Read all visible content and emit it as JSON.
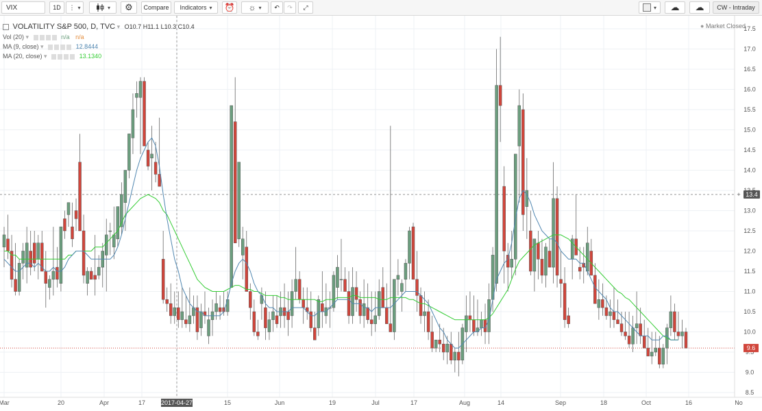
{
  "toolbar": {
    "symbol": "VIX",
    "interval": "1D",
    "compare_label": "Compare",
    "indicators_label": "Indicators",
    "layout_label": "CW - Intraday"
  },
  "legend": {
    "title": "VOLATILITY S&P 500, D, TVC",
    "ohlc": {
      "open": "O10.7",
      "high": "H11.1",
      "low": "L10.3",
      "close": "C10.4"
    },
    "vol": {
      "label": "Vol (20)",
      "v1": "n/a",
      "v2": "n/a"
    },
    "ma9": {
      "label": "MA (9, close)",
      "value": "12.8444"
    },
    "ma20": {
      "label": "MA (20, close)",
      "value": "13.1340"
    },
    "market_status": "Market Closed"
  },
  "colors": {
    "up": "#6b9e7e",
    "down": "#d1453b",
    "ma9": "#4f86b0",
    "ma20": "#33cc33",
    "grid": "#eef1f4",
    "crosshair": "#999999"
  },
  "y_axis": {
    "ticks": [
      "17.5",
      "17.0",
      "16.5",
      "16.0",
      "15.5",
      "15.0",
      "14.5",
      "14.0",
      "13.5",
      "13.0",
      "12.5",
      "12.0",
      "11.5",
      "11.0",
      "10.5",
      "10.0",
      "9.5",
      "9.0",
      "8.5"
    ],
    "crosshair_value": "13.4",
    "price_value": "9.6"
  },
  "x_axis": {
    "ticks": [
      "Mar",
      "20",
      "Apr",
      "17",
      "2017-04-27",
      "15",
      "Jun",
      "19",
      "Jul",
      "17",
      "Aug",
      "14",
      "Sep",
      "18",
      "Oct",
      "16",
      "No"
    ]
  },
  "chart_data": {
    "type": "candlestick",
    "title": "VOLATILITY S&P 500, D, TVC",
    "ylim": [
      8.5,
      17.5
    ],
    "ohlc": [
      [
        12.1,
        12.6,
        11.6,
        12.4
      ],
      [
        12.3,
        12.9,
        11.8,
        12.0
      ],
      [
        12.0,
        12.4,
        11.1,
        11.3
      ],
      [
        11.3,
        12.2,
        10.9,
        11.0
      ],
      [
        11.0,
        11.8,
        10.9,
        11.7
      ],
      [
        11.7,
        12.2,
        11.3,
        12.0
      ],
      [
        11.6,
        12.6,
        11.2,
        12.2
      ],
      [
        12.0,
        12.5,
        11.4,
        11.6
      ],
      [
        12.2,
        12.5,
        11.5,
        11.7
      ],
      [
        11.8,
        12.4,
        11.3,
        12.2
      ],
      [
        12.2,
        12.5,
        11.6,
        11.5
      ],
      [
        11.5,
        12.0,
        10.6,
        11.2
      ],
      [
        11.1,
        11.4,
        10.8,
        11.3
      ],
      [
        11.3,
        12.6,
        10.9,
        11.5
      ],
      [
        11.6,
        12.1,
        11.1,
        11.3
      ],
      [
        11.2,
        12.4,
        11.0,
        12.6
      ],
      [
        12.8,
        13.0,
        12.3,
        12.5
      ],
      [
        12.9,
        13.1,
        12.6,
        13.2
      ],
      [
        12.6,
        13.2,
        12.1,
        12.3
      ],
      [
        13.0,
        13.3,
        12.5,
        12.8
      ],
      [
        14.2,
        14.9,
        12.8,
        12.5
      ],
      [
        12.5,
        12.9,
        11.2,
        11.4
      ],
      [
        11.2,
        11.6,
        10.9,
        11.5
      ],
      [
        11.5,
        11.6,
        11.3,
        11.3
      ],
      [
        11.4,
        12.4,
        10.9,
        11.3
      ],
      [
        11.4,
        11.9,
        11.3,
        11.6
      ],
      [
        11.6,
        12.2,
        11.1,
        12.0
      ],
      [
        11.9,
        12.8,
        11.0,
        12.4
      ],
      [
        12.5,
        12.7,
        11.9,
        12.5
      ],
      [
        12.1,
        13.1,
        11.8,
        12.4
      ],
      [
        12.3,
        13.0,
        12.1,
        13.1
      ],
      [
        12.6,
        13.7,
        12.4,
        13.4
      ],
      [
        13.2,
        14.0,
        12.5,
        14.0
      ],
      [
        14.0,
        14.6,
        13.8,
        14.9
      ],
      [
        14.8,
        15.9,
        14.4,
        15.5
      ],
      [
        15.8,
        16.2,
        15.3,
        15.9
      ],
      [
        15.8,
        16.3,
        14.4,
        16.2
      ],
      [
        16.2,
        16.3,
        14.9,
        14.6
      ],
      [
        14.5,
        14.7,
        14.0,
        14.1
      ],
      [
        14.3,
        15.1,
        13.5,
        14.4
      ],
      [
        14.2,
        14.7,
        13.7,
        13.9
      ],
      [
        13.9,
        15.3,
        13.6,
        13.6
      ],
      [
        11.8,
        12.5,
        10.7,
        10.8
      ],
      [
        10.8,
        11.1,
        10.5,
        10.7
      ],
      [
        10.7,
        11.2,
        10.2,
        10.4
      ],
      [
        10.4,
        11.0,
        10.2,
        10.6
      ],
      [
        10.6,
        11.0,
        10.1,
        10.3
      ],
      [
        10.3,
        11.1,
        10.1,
        10.5
      ],
      [
        10.3,
        10.9,
        10.1,
        10.2
      ],
      [
        10.2,
        11.1,
        10.0,
        10.4
      ],
      [
        10.4,
        10.9,
        10.2,
        10.6
      ],
      [
        10.6,
        10.9,
        9.8,
        10.0
      ],
      [
        10.1,
        10.7,
        9.9,
        10.5
      ],
      [
        10.5,
        11.0,
        10.2,
        10.4
      ],
      [
        9.9,
        10.6,
        9.7,
        10.3
      ],
      [
        10.3,
        10.8,
        9.9,
        10.5
      ],
      [
        10.5,
        11.0,
        10.3,
        10.7
      ],
      [
        10.6,
        10.9,
        10.3,
        10.5
      ],
      [
        10.6,
        11.0,
        10.4,
        10.5
      ],
      [
        10.5,
        11.0,
        10.4,
        10.8
      ],
      [
        11.1,
        15.6,
        11.4,
        15.6
      ],
      [
        15.2,
        16.3,
        12.4,
        12.2
      ],
      [
        12.3,
        14.2,
        12.1,
        14.2
      ],
      [
        11.9,
        12.6,
        11.3,
        12.3
      ],
      [
        12.1,
        12.5,
        11.1,
        11.0
      ],
      [
        11.0,
        11.2,
        10.3,
        10.6
      ],
      [
        10.5,
        10.8,
        9.9,
        10.0
      ],
      [
        10.0,
        10.3,
        9.8,
        9.9
      ],
      [
        10.7,
        11.1,
        10.3,
        10.9
      ],
      [
        10.6,
        11.0,
        9.8,
        10.1
      ],
      [
        10.0,
        10.5,
        9.8,
        10.3
      ],
      [
        10.3,
        10.9,
        10.0,
        10.5
      ],
      [
        10.4,
        10.9,
        10.1,
        10.2
      ],
      [
        10.4,
        11.0,
        10.1,
        10.6
      ],
      [
        10.6,
        11.2,
        10.1,
        10.4
      ],
      [
        10.5,
        11.0,
        9.9,
        10.3
      ],
      [
        10.4,
        11.3,
        10.1,
        11.0
      ],
      [
        11.0,
        12.1,
        10.8,
        11.3
      ],
      [
        11.3,
        11.5,
        10.7,
        10.8
      ],
      [
        10.8,
        11.1,
        10.2,
        10.6
      ],
      [
        10.6,
        11.1,
        10.3,
        10.5
      ],
      [
        10.5,
        11.0,
        10.0,
        10.1
      ],
      [
        10.1,
        10.5,
        9.9,
        9.8
      ],
      [
        10.1,
        10.9,
        9.9,
        10.8
      ],
      [
        10.7,
        11.5,
        10.1,
        10.5
      ],
      [
        10.4,
        11.2,
        10.2,
        10.6
      ],
      [
        10.6,
        11.0,
        10.1,
        10.6
      ],
      [
        10.6,
        11.5,
        10.5,
        11.4
      ],
      [
        11.1,
        11.9,
        10.8,
        11.6
      ],
      [
        11.3,
        12.3,
        11.0,
        11.3
      ],
      [
        11.3,
        11.6,
        11.0,
        11.0
      ],
      [
        11.0,
        11.5,
        10.2,
        10.4
      ],
      [
        10.4,
        11.6,
        10.2,
        11.1
      ],
      [
        11.1,
        11.5,
        10.5,
        10.8
      ],
      [
        10.8,
        11.0,
        10.2,
        10.4
      ],
      [
        10.4,
        11.3,
        10.1,
        10.7
      ],
      [
        10.6,
        11.2,
        10.2,
        10.3
      ],
      [
        10.3,
        11.0,
        9.9,
        10.2
      ],
      [
        10.2,
        11.0,
        10.0,
        10.4
      ],
      [
        10.4,
        11.3,
        10.3,
        11.0
      ],
      [
        11.1,
        11.6,
        10.8,
        10.6
      ],
      [
        10.6,
        11.2,
        10.3,
        10.2
      ],
      [
        10.2,
        15.1,
        10.0,
        10.0
      ],
      [
        10.0,
        11.2,
        9.8,
        11.3
      ],
      [
        11.3,
        11.8,
        10.9,
        11.4
      ],
      [
        11.0,
        11.3,
        10.5,
        11.2
      ],
      [
        11.3,
        11.8,
        11.0,
        11.7
      ],
      [
        11.7,
        12.6,
        11.3,
        12.5
      ],
      [
        12.6,
        12.7,
        11.3,
        11.3
      ],
      [
        11.3,
        12.0,
        10.5,
        10.9
      ],
      [
        10.9,
        11.1,
        10.2,
        10.4
      ],
      [
        10.4,
        11.0,
        10.0,
        10.5
      ],
      [
        10.5,
        10.8,
        9.8,
        10.0
      ],
      [
        10.0,
        10.4,
        9.5,
        9.6
      ],
      [
        9.6,
        9.8,
        9.5,
        9.8
      ],
      [
        9.8,
        10.2,
        9.5,
        9.7
      ],
      [
        9.7,
        10.1,
        9.3,
        9.5
      ],
      [
        9.5,
        9.9,
        9.2,
        9.7
      ],
      [
        9.7,
        10.0,
        9.2,
        9.3
      ],
      [
        9.3,
        9.6,
        9.0,
        9.5
      ],
      [
        9.5,
        10.0,
        8.9,
        9.3
      ],
      [
        9.3,
        10.2,
        9.2,
        10.1
      ],
      [
        10.0,
        10.9,
        9.5,
        10.4
      ],
      [
        10.4,
        11.0,
        10.0,
        10.3
      ],
      [
        10.3,
        10.9,
        9.9,
        10.0
      ],
      [
        10.0,
        10.8,
        9.9,
        10.1
      ],
      [
        10.1,
        10.5,
        9.9,
        10.3
      ],
      [
        10.3,
        10.7,
        9.7,
        10.0
      ],
      [
        10.0,
        11.2,
        9.7,
        10.8
      ],
      [
        10.8,
        12.1,
        10.5,
        11.9
      ],
      [
        11.2,
        17.0,
        11.0,
        16.1
      ],
      [
        16.1,
        17.3,
        14.7,
        15.6
      ],
      [
        13.6,
        14.1,
        11.2,
        12.0
      ],
      [
        11.9,
        12.2,
        11.0,
        11.6
      ],
      [
        11.6,
        12.5,
        11.3,
        11.8
      ],
      [
        11.8,
        13.6,
        11.4,
        14.4
      ],
      [
        14.6,
        16.0,
        13.2,
        15.6
      ],
      [
        15.5,
        15.9,
        12.5,
        12.9
      ],
      [
        13.1,
        14.3,
        12.3,
        13.5
      ],
      [
        12.5,
        13.0,
        11.4,
        11.5
      ],
      [
        11.5,
        12.3,
        11.0,
        12.3
      ],
      [
        12.2,
        12.5,
        11.3,
        11.8
      ],
      [
        11.8,
        12.3,
        11.2,
        11.4
      ],
      [
        11.4,
        12.2,
        11.1,
        12.1
      ],
      [
        12.0,
        12.3,
        11.6,
        11.6
      ],
      [
        11.6,
        14.2,
        11.2,
        13.3
      ],
      [
        13.3,
        13.6,
        11.1,
        11.4
      ],
      [
        11.3,
        12.0,
        10.6,
        11.2
      ],
      [
        11.2,
        11.6,
        10.1,
        10.3
      ],
      [
        10.4,
        10.6,
        10.1,
        10.2
      ],
      [
        11.8,
        12.4,
        11.3,
        12.3
      ],
      [
        12.3,
        13.4,
        11.9,
        11.9
      ],
      [
        11.6,
        12.1,
        11.3,
        11.5
      ],
      [
        11.7,
        12.1,
        11.2,
        11.6
      ],
      [
        11.5,
        12.6,
        11.4,
        12.2
      ],
      [
        12.0,
        12.3,
        11.6,
        11.4
      ],
      [
        11.4,
        11.7,
        10.7,
        10.7
      ],
      [
        10.6,
        11.3,
        10.3,
        10.8
      ],
      [
        10.8,
        11.2,
        10.4,
        10.6
      ],
      [
        10.6,
        10.9,
        10.3,
        10.4
      ],
      [
        10.4,
        10.8,
        10.1,
        10.5
      ],
      [
        10.5,
        11.1,
        10.1,
        10.3
      ],
      [
        10.3,
        10.8,
        10.2,
        10.2
      ],
      [
        10.2,
        10.5,
        9.9,
        10.0
      ],
      [
        10.0,
        10.5,
        9.8,
        9.9
      ],
      [
        9.9,
        10.5,
        9.6,
        9.7
      ],
      [
        9.7,
        10.4,
        9.5,
        10.1
      ],
      [
        10.1,
        11.0,
        9.7,
        10.2
      ],
      [
        10.2,
        10.6,
        9.7,
        9.9
      ],
      [
        9.9,
        10.3,
        9.6,
        9.6
      ],
      [
        9.6,
        10.1,
        9.5,
        9.4
      ],
      [
        9.4,
        10.0,
        9.2,
        9.5
      ],
      [
        9.5,
        10.0,
        9.4,
        9.6
      ],
      [
        9.6,
        9.9,
        9.1,
        9.2
      ],
      [
        9.2,
        9.7,
        9.1,
        9.6
      ],
      [
        9.6,
        10.2,
        9.2,
        10.1
      ],
      [
        10.1,
        10.9,
        9.9,
        10.5
      ],
      [
        10.5,
        10.7,
        9.8,
        10.0
      ],
      [
        10.0,
        10.5,
        9.8,
        9.9
      ],
      [
        9.9,
        10.3,
        9.6,
        10.0
      ],
      [
        10.0,
        10.1,
        9.6,
        9.6
      ]
    ],
    "ma9": [
      11.8,
      11.7,
      11.6,
      11.5,
      11.5,
      11.6,
      11.7,
      11.7,
      11.6,
      11.7,
      11.6,
      11.5,
      11.5,
      11.6,
      11.5,
      11.5,
      11.6,
      11.8,
      11.9,
      12.0,
      12.0,
      12.0,
      11.9,
      11.8,
      11.8,
      11.8,
      11.8,
      11.8,
      11.8,
      11.9,
      12.1,
      12.4,
      12.8,
      13.2,
      13.6,
      14.0,
      14.3,
      14.5,
      14.7,
      14.8,
      14.6,
      14.1,
      13.4,
      12.8,
      12.3,
      11.8,
      11.5,
      11.1,
      10.9,
      10.7,
      10.6,
      10.5,
      10.5,
      10.4,
      10.4,
      10.4,
      10.4,
      10.4,
      10.5,
      10.8,
      11.2,
      11.5,
      11.7,
      11.8,
      11.7,
      11.5,
      11.2,
      11.0,
      10.9,
      10.7,
      10.6,
      10.6,
      10.5,
      10.5,
      10.5,
      10.5,
      10.6,
      10.6,
      10.6,
      10.6,
      10.5,
      10.4,
      10.4,
      10.5,
      10.5,
      10.5,
      10.6,
      10.7,
      10.8,
      10.8,
      10.8,
      10.8,
      10.7,
      10.7,
      10.7,
      10.6,
      10.6,
      10.5,
      10.6,
      10.6,
      10.6,
      10.6,
      10.6,
      10.7,
      10.8,
      10.9,
      11.0,
      11.0,
      11.0,
      11.0,
      10.9,
      10.8,
      10.7,
      10.5,
      10.3,
      10.1,
      10.0,
      9.8,
      9.7,
      9.6,
      9.6,
      9.7,
      9.8,
      9.9,
      10.0,
      10.0,
      10.1,
      10.1,
      10.3,
      10.8,
      11.3,
      11.5,
      11.7,
      11.8,
      12.2,
      12.8,
      13.3,
      13.5,
      13.4,
      13.2,
      12.9,
      12.7,
      12.5,
      12.4,
      12.3,
      12.3,
      12.2,
      12.0,
      11.9,
      11.8,
      11.8,
      11.8,
      11.7,
      11.7,
      11.5,
      11.3,
      11.1,
      11.0,
      10.9,
      10.8,
      10.6,
      10.5,
      10.5,
      10.4,
      10.3,
      10.2,
      10.1,
      10.0,
      9.9,
      9.9,
      9.9,
      9.8,
      9.8,
      9.8,
      9.9,
      9.9,
      9.8,
      9.8,
      9.8
    ],
    "ma20": [
      12.0,
      12.0,
      11.9,
      11.9,
      11.8,
      11.8,
      11.8,
      11.8,
      11.8,
      11.8,
      11.8,
      11.8,
      11.8,
      11.8,
      11.8,
      11.8,
      11.8,
      11.9,
      11.9,
      12.0,
      12.0,
      12.0,
      12.0,
      12.0,
      12.1,
      12.1,
      12.1,
      12.2,
      12.3,
      12.4,
      12.5,
      12.7,
      12.9,
      13.0,
      13.1,
      13.2,
      13.3,
      13.35,
      13.4,
      13.35,
      13.3,
      13.2,
      13.0,
      12.9,
      12.7,
      12.5,
      12.3,
      12.1,
      11.9,
      11.7,
      11.5,
      11.3,
      11.2,
      11.1,
      11.05,
      11.0,
      11.0,
      11.0,
      11.0,
      11.05,
      11.1,
      11.15,
      11.15,
      11.1,
      11.05,
      11.05,
      11.0,
      11.0,
      10.95,
      10.9,
      10.9,
      10.9,
      10.9,
      10.85,
      10.85,
      10.8,
      10.8,
      10.8,
      10.8,
      10.8,
      10.8,
      10.8,
      10.8,
      10.75,
      10.75,
      10.8,
      10.8,
      10.8,
      10.85,
      10.85,
      10.85,
      10.85,
      10.9,
      10.9,
      10.85,
      10.85,
      10.85,
      10.85,
      10.85,
      10.8,
      10.8,
      10.8,
      10.85,
      10.85,
      10.85,
      10.85,
      10.85,
      10.8,
      10.8,
      10.75,
      10.7,
      10.7,
      10.65,
      10.6,
      10.55,
      10.5,
      10.45,
      10.4,
      10.35,
      10.3,
      10.3,
      10.3,
      10.3,
      10.3,
      10.3,
      10.3,
      10.3,
      10.3,
      10.35,
      10.45,
      10.6,
      10.75,
      10.9,
      11.05,
      11.3,
      11.55,
      11.75,
      11.85,
      11.95,
      12.05,
      12.15,
      12.2,
      12.25,
      12.3,
      12.35,
      12.4,
      12.4,
      12.4,
      12.35,
      12.3,
      12.2,
      12.1,
      12.0,
      11.9,
      11.8,
      11.7,
      11.6,
      11.5,
      11.4,
      11.3,
      11.2,
      11.1,
      11.0,
      10.95,
      10.85,
      10.8,
      10.7,
      10.6,
      10.5,
      10.4,
      10.3,
      10.2,
      10.1,
      10.0,
      9.9,
      9.85,
      9.8,
      9.8,
      9.8
    ]
  }
}
